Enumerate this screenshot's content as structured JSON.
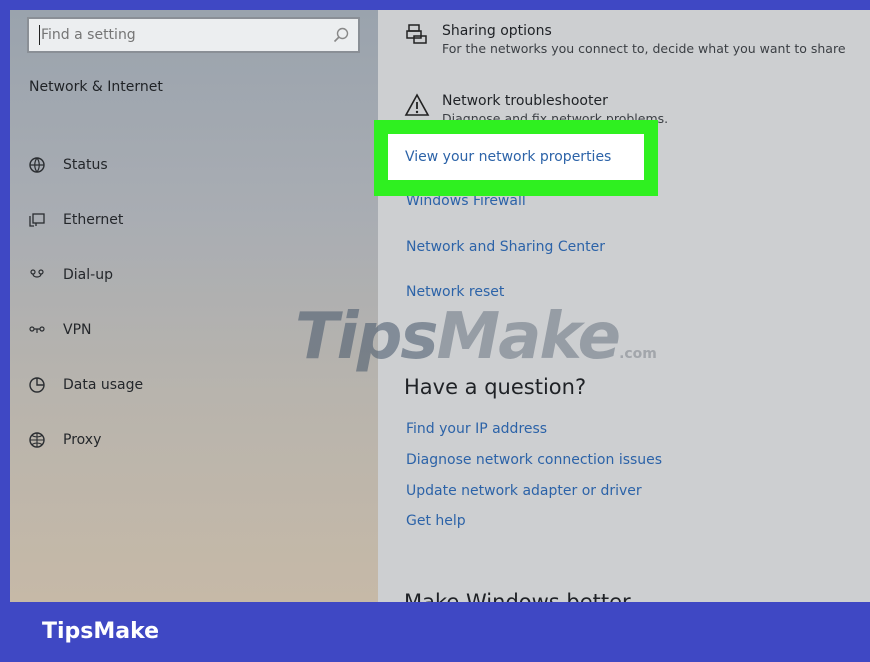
{
  "search": {
    "placeholder": "Find a setting"
  },
  "sidebar": {
    "title": "Network & Internet",
    "items": [
      {
        "label": "Status",
        "icon": "globe-status-icon"
      },
      {
        "label": "Ethernet",
        "icon": "ethernet-icon"
      },
      {
        "label": "Dial-up",
        "icon": "dial-up-icon"
      },
      {
        "label": "VPN",
        "icon": "vpn-icon"
      },
      {
        "label": "Data usage",
        "icon": "data-usage-icon"
      },
      {
        "label": "Proxy",
        "icon": "globe-icon"
      }
    ]
  },
  "main": {
    "sharing": {
      "title": "Sharing options",
      "desc": "For the networks you connect to, decide what you want to share"
    },
    "troubleshooter": {
      "title": "Network troubleshooter",
      "desc": "Diagnose and fix network problems."
    },
    "links": {
      "view_props": "View your network properties",
      "firewall": "Windows Firewall",
      "sharing_center": "Network and Sharing Center",
      "reset": "Network reset"
    },
    "question_heading": "Have a question?",
    "help_links": [
      "Find your IP address",
      "Diagnose network connection issues",
      "Update network adapter or driver",
      "Get help"
    ],
    "better_heading": "Make Windows better"
  },
  "watermark": {
    "part1": "Tips",
    "part2": "Make",
    "part3": ".com"
  },
  "brand": "TipsMake",
  "colors": {
    "frame": "#3f48c4",
    "highlight": "#2ff020",
    "link": "#2c63a8"
  }
}
